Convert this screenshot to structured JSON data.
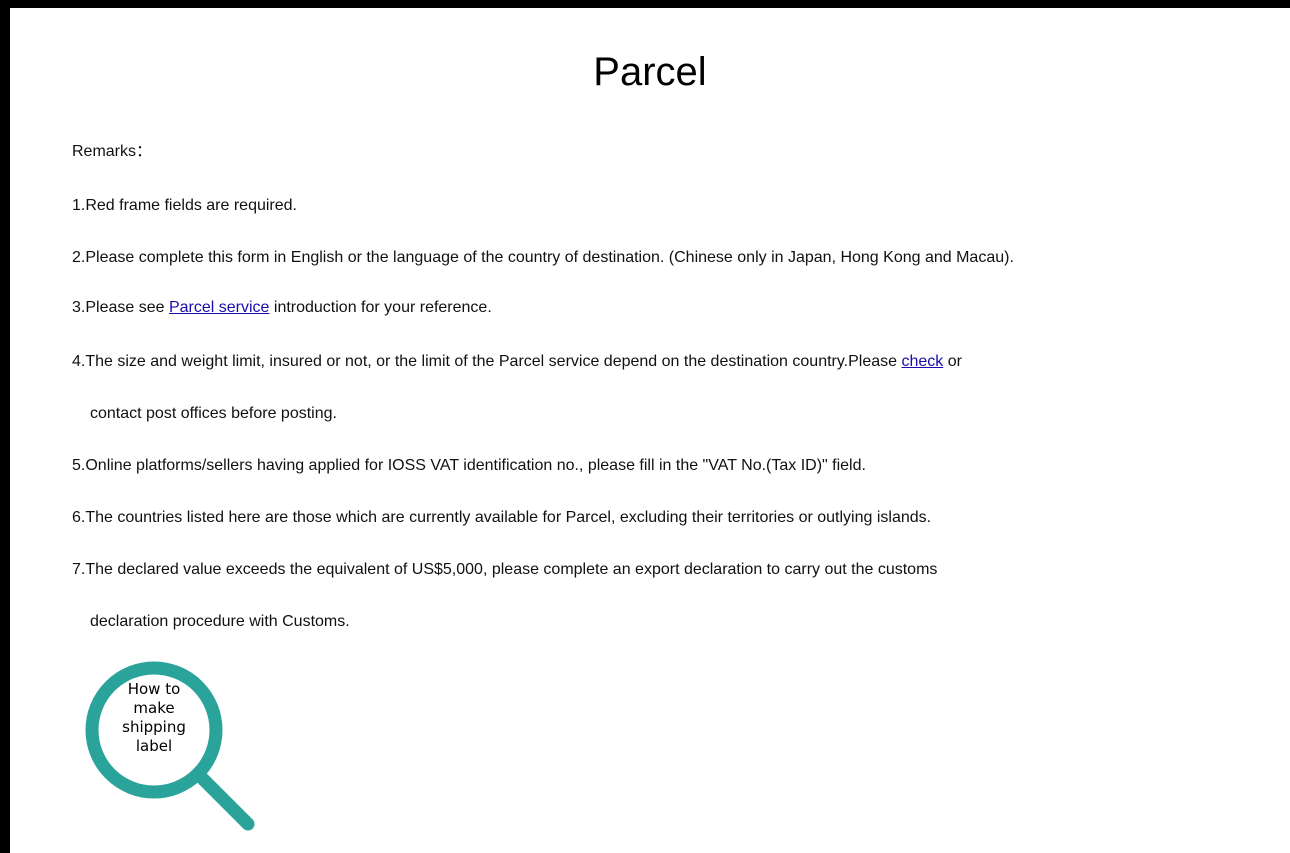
{
  "page": {
    "title": "Parcel",
    "remarks_label": "Remarks："
  },
  "remarks": {
    "item1": "1.Red frame fields are required.",
    "item2": "2.Please complete this form in English or the language of the country of destination. (Chinese only in Japan, Hong Kong and Macau).",
    "item3_before": "3.Please see ",
    "item3_link": "Parcel service",
    "item3_after": " introduction for your reference.",
    "item4_before": "4.The size and weight limit, insured or not, or the limit of the Parcel service depend on the destination country.Please ",
    "item4_link": "check",
    "item4_after": " or",
    "item4_cont": "contact post offices before posting.",
    "item5": "5.Online platforms/sellers having applied for IOSS VAT identification no., please fill in the \"VAT No.(Tax ID)\" field.",
    "item6": "6.The countries listed here are those which are currently available for Parcel, excluding their territories or outlying islands.",
    "item7": "7.The declared value exceeds the equivalent of US$5,000, please complete an export declaration to carry out the customs",
    "item7_cont": "declaration procedure with Customs."
  },
  "howto": {
    "line1": "How to",
    "line2": "make",
    "line3": "shipping",
    "line4": "label",
    "icon": "magnifier-icon",
    "color": "#2aa39a"
  },
  "colors": {
    "link": "#1a0dab",
    "frame": "#000000",
    "background": "#ffffff"
  }
}
